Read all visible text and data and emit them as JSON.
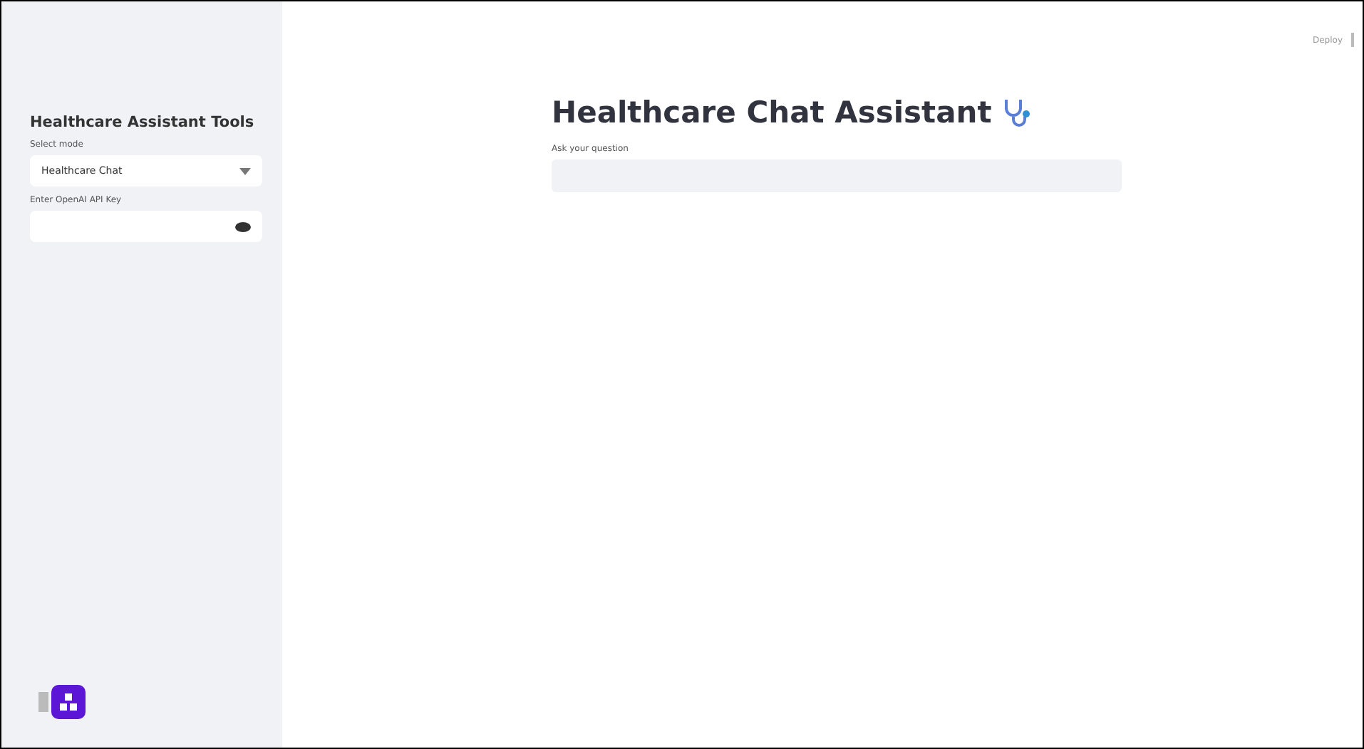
{
  "sidebar": {
    "title": "Healthcare Assistant Tools",
    "mode_select": {
      "label": "Select mode",
      "value": "Healthcare Chat"
    },
    "api_key": {
      "label": "Enter OpenAI API Key",
      "masked": true
    }
  },
  "header": {
    "deploy": "Deploy"
  },
  "main": {
    "title": "Healthcare Chat Assistant",
    "question": {
      "label": "Ask your question"
    }
  }
}
